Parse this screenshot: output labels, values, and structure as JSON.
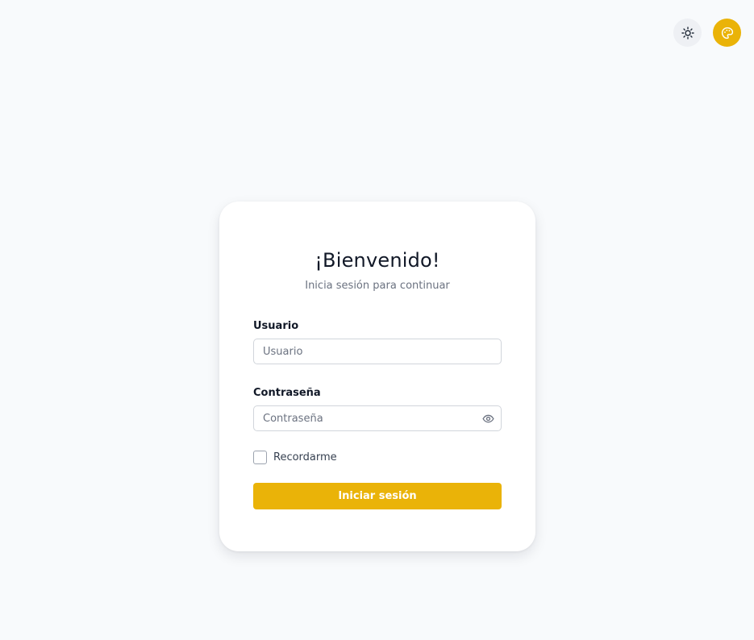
{
  "header": {
    "theme_toggle_icon": "sun-icon",
    "palette_icon": "palette-icon",
    "accent_color": "#eab308"
  },
  "login": {
    "title": "¡Bienvenido!",
    "subtitle": "Inicia sesión para continuar",
    "username": {
      "label": "Usuario",
      "placeholder": "Usuario",
      "value": ""
    },
    "password": {
      "label": "Contraseña",
      "placeholder": "Contraseña",
      "value": "",
      "toggle_icon": "eye-icon"
    },
    "remember": {
      "label": "Recordarme",
      "checked": false
    },
    "submit_label": "Iniciar sesión"
  }
}
